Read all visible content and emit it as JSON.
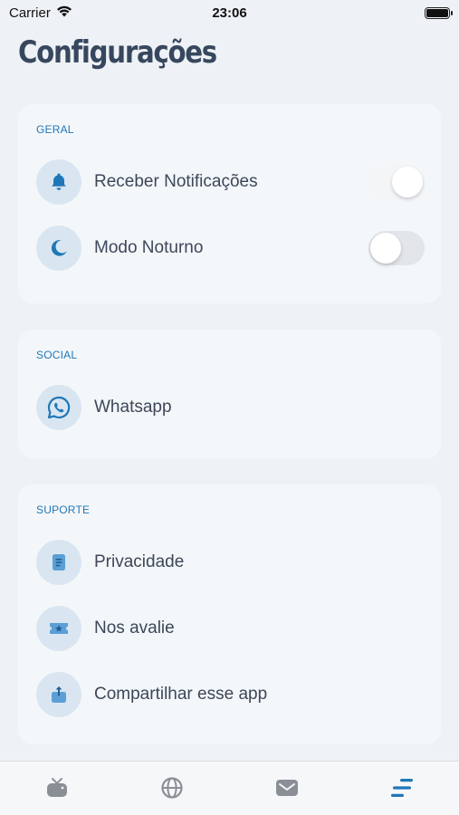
{
  "status_bar": {
    "carrier": "Carrier",
    "time": "23:06",
    "battery_level": 1.0
  },
  "page": {
    "title": "Configurações"
  },
  "sections": {
    "geral": {
      "title": "GERAL",
      "items": [
        {
          "label": "Receber Notificações",
          "icon": "bell-icon",
          "toggle": true
        },
        {
          "label": "Modo Noturno",
          "icon": "moon-icon",
          "toggle": false
        }
      ]
    },
    "social": {
      "title": "SOCIAL",
      "items": [
        {
          "label": "Whatsapp",
          "icon": "whatsapp-icon"
        }
      ]
    },
    "suporte": {
      "title": "SUPORTE",
      "items": [
        {
          "label": "Privacidade",
          "icon": "document-icon"
        },
        {
          "label": "Nos avalie",
          "icon": "star-ticket-icon"
        },
        {
          "label": "Compartilhar esse app",
          "icon": "share-icon"
        }
      ]
    }
  },
  "tab_bar": {
    "tabs": [
      {
        "icon": "tv-icon",
        "active": false
      },
      {
        "icon": "globe-icon",
        "active": false
      },
      {
        "icon": "mail-icon",
        "active": false
      },
      {
        "icon": "menu-lines-icon",
        "active": true
      }
    ]
  },
  "colors": {
    "accent": "#1f77b8",
    "icon_bg": "#d9e6f1",
    "inactive_tab": "#8a8f96",
    "background": "#eef2f6",
    "card": "#f4f7fa"
  }
}
